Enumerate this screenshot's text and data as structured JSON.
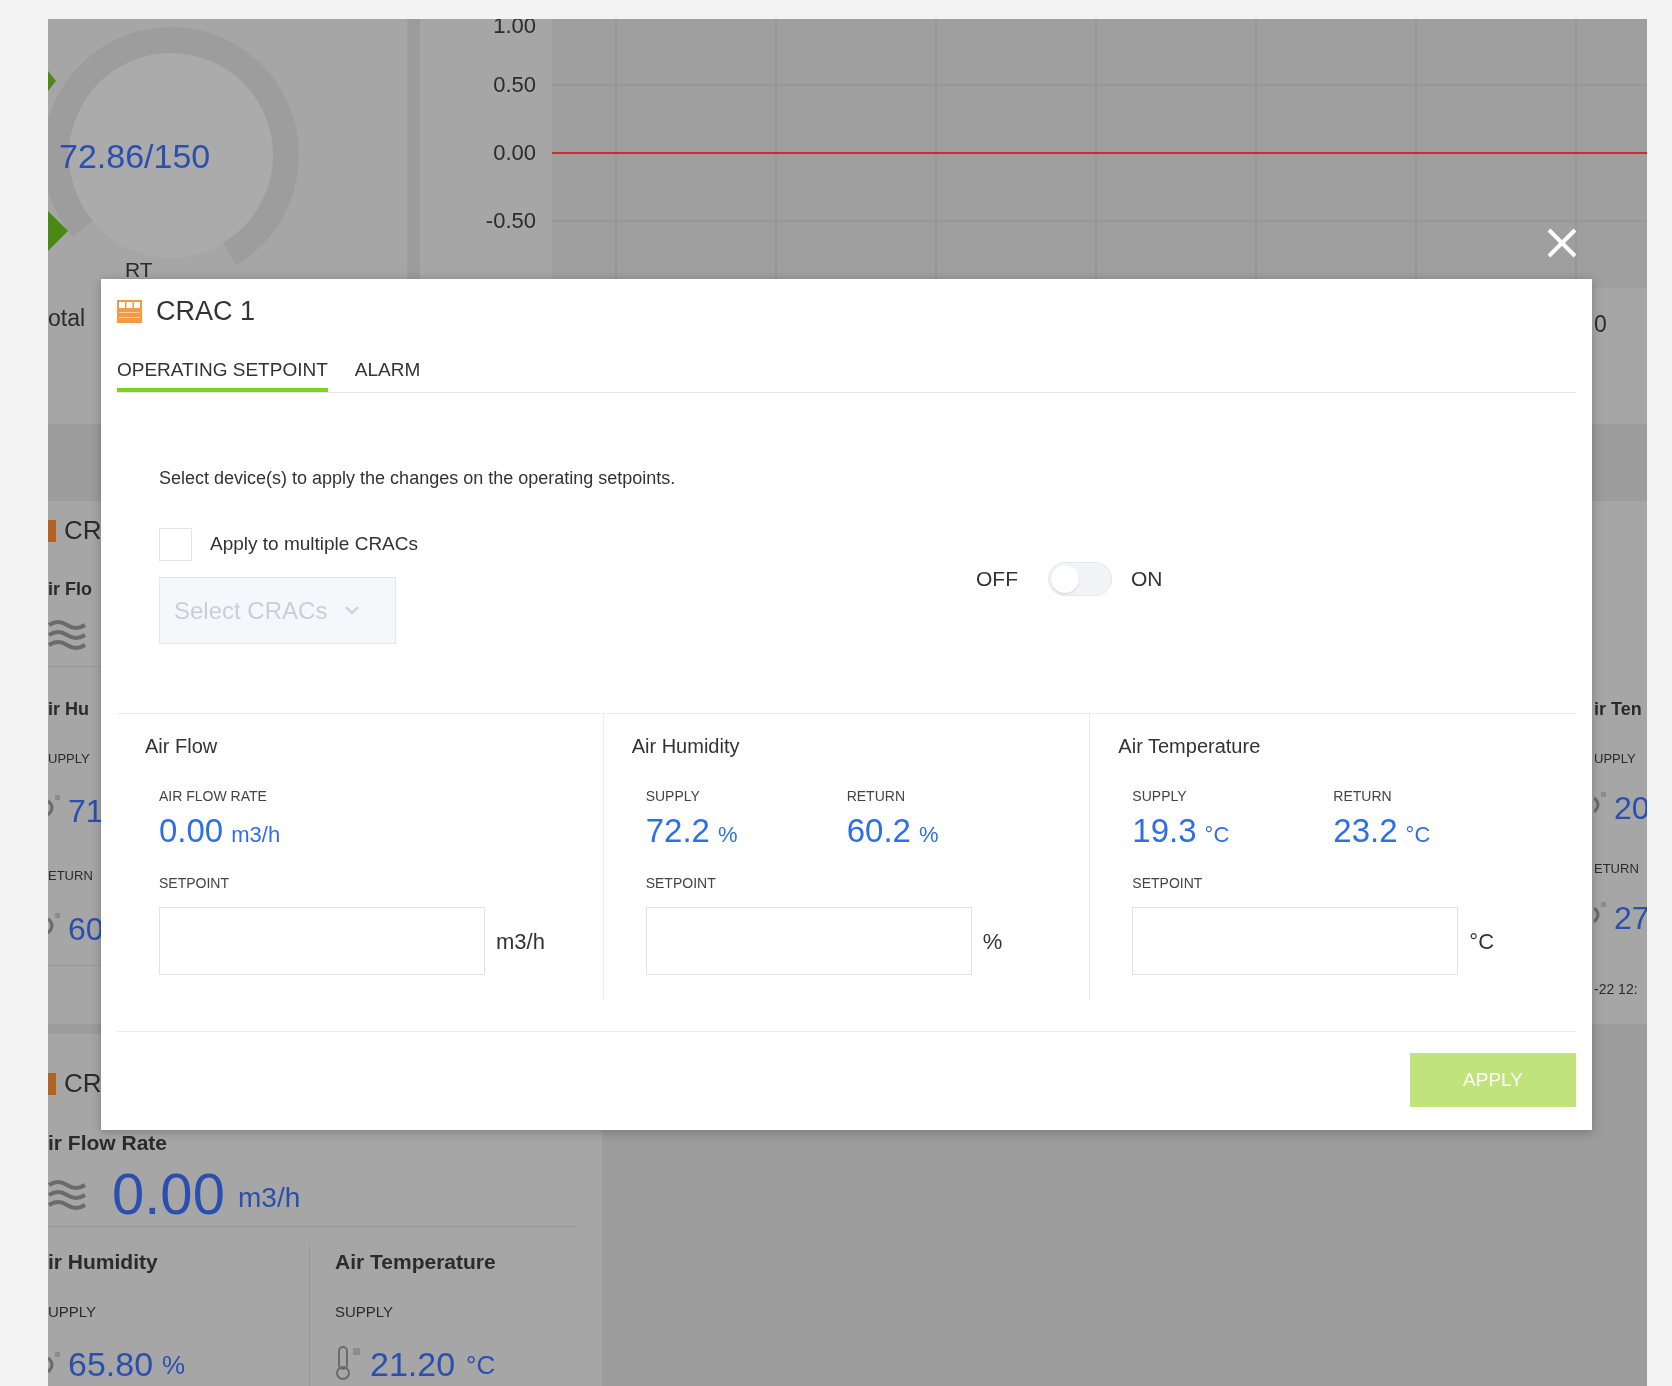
{
  "background": {
    "gauge_reading": "72.86/150",
    "gauge_label": "RT",
    "gauge_caption": "otal",
    "chart": {
      "chart_data": {
        "type": "line",
        "ylim": [
          -1,
          1
        ],
        "yticks": [
          {
            "value": 1,
            "label": "1.00"
          },
          {
            "value": 0.5,
            "label": "0.50"
          },
          {
            "value": 0,
            "label": "0.00"
          },
          {
            "value": -0.5,
            "label": "-0.50"
          }
        ],
        "series": [
          {
            "color": "#d62828",
            "values": [
              0,
              0,
              0,
              0,
              0,
              0,
              0,
              0
            ]
          }
        ]
      }
    },
    "chart_side_value": "0",
    "left_card": {
      "title": "CR",
      "flow_label": "ir Flo",
      "humidity_label": "ir Hu",
      "supply_label": "UPPLY",
      "supply_value": "71",
      "return_label": "ETURN",
      "return_value": "60"
    },
    "right_card": {
      "title": "ir Ten",
      "supply_label": "UPPLY",
      "supply_value": "20",
      "return_label": "ETURN",
      "return_value": "27",
      "timestamp": "-22 12:"
    },
    "lower_card": {
      "title": "CR",
      "flow_label": "ir Flow Rate",
      "flow_value": "0.00",
      "flow_unit": "m3/h",
      "humidity_title": "ir Humidity",
      "humidity_supply_label": "UPPLY",
      "humidity_value": "65.80",
      "humidity_unit": "%",
      "temperature_title": "Air Temperature",
      "temperature_supply_label": "SUPPLY",
      "temperature_value": "21.20",
      "temperature_unit": "°C"
    }
  },
  "dialog": {
    "title": "CRAC 1",
    "tabs": [
      {
        "label": "OPERATING SETPOINT",
        "selected": true
      },
      {
        "label": "ALARM",
        "selected": false
      }
    ],
    "instruction": "Select device(s) to apply the changes on the operating setpoints.",
    "apply_multiple": {
      "label": "Apply to multiple CRACs",
      "checked": false
    },
    "crac_select": {
      "placeholder": "Select CRACs",
      "disabled": true
    },
    "power": {
      "off_label": "OFF",
      "on_label": "ON",
      "on": false
    },
    "sections": [
      {
        "title": "Air Flow",
        "readings": [
          {
            "label": "AIR FLOW RATE",
            "value": "0.00",
            "unit": "m3/h"
          }
        ],
        "setpoint_label": "SETPOINT",
        "setpoint_unit": "m3/h"
      },
      {
        "title": "Air Humidity",
        "readings": [
          {
            "label": "SUPPLY",
            "value": "72.2",
            "unit": "%"
          },
          {
            "label": "RETURN",
            "value": "60.2",
            "unit": "%"
          }
        ],
        "setpoint_label": "SETPOINT",
        "setpoint_unit": "%"
      },
      {
        "title": "Air Temperature",
        "readings": [
          {
            "label": "SUPPLY",
            "value": "19.3",
            "unit": "°C"
          },
          {
            "label": "RETURN",
            "value": "23.2",
            "unit": "°C"
          }
        ],
        "setpoint_label": "SETPOINT",
        "setpoint_unit": "°C"
      }
    ],
    "apply_button": {
      "label": "APPLY",
      "disabled": true
    }
  }
}
